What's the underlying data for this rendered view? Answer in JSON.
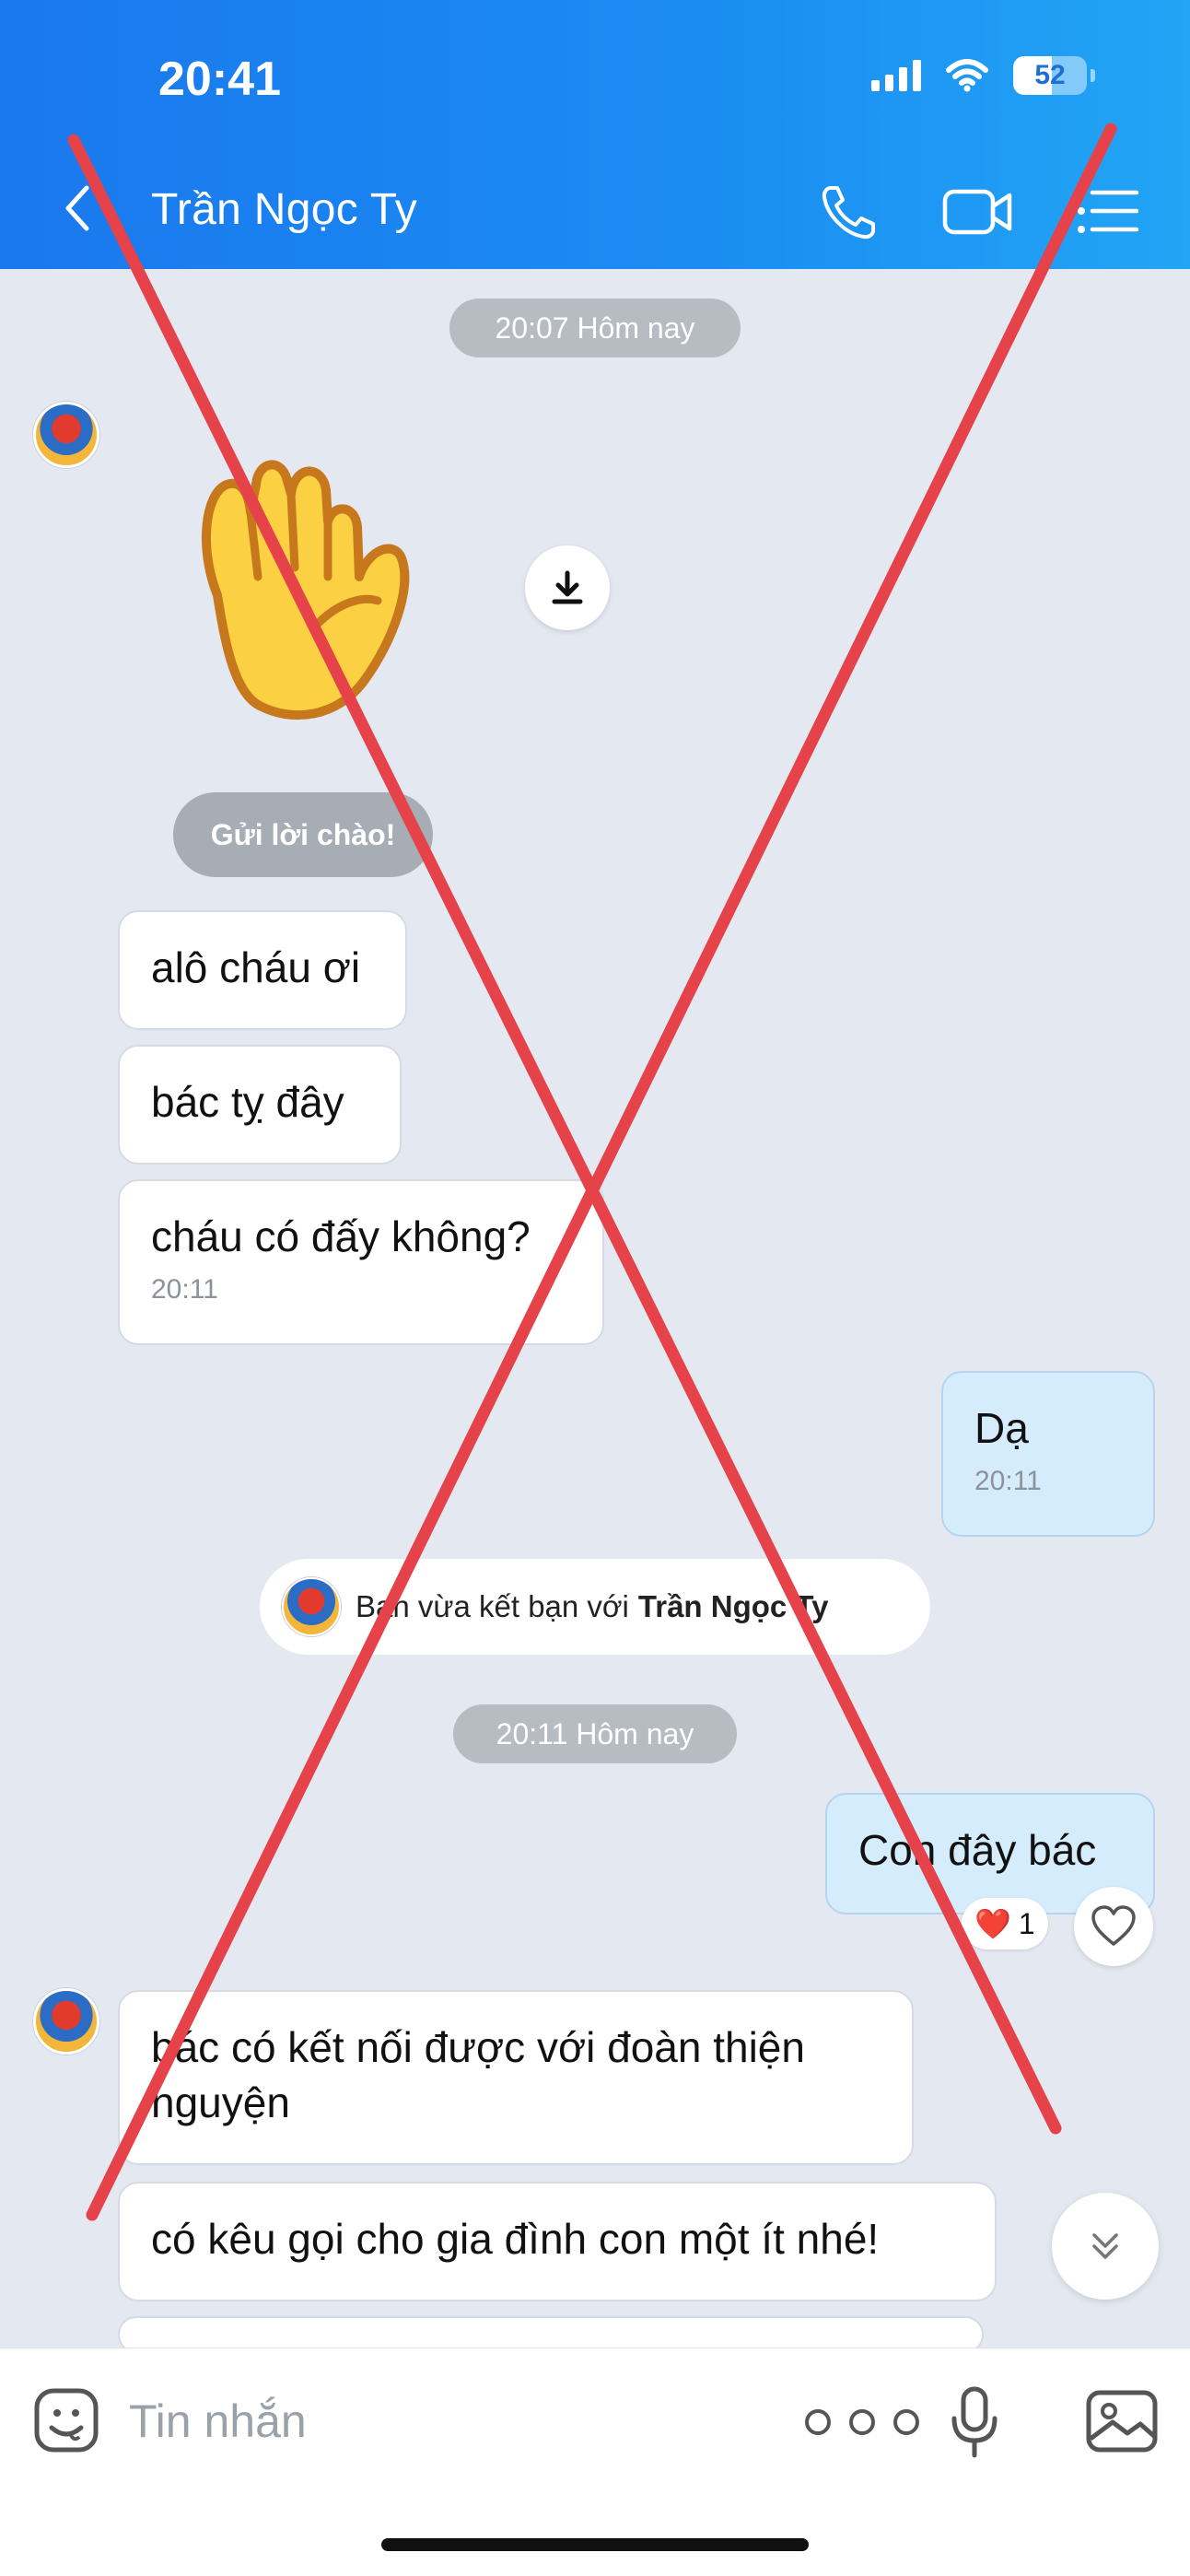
{
  "status_bar": {
    "time": "20:41",
    "battery": "52"
  },
  "header": {
    "contact_name": "Trần Ngọc Ty"
  },
  "timestamps": [
    "20:07 Hôm nay",
    "20:11 Hôm nay"
  ],
  "greeting_button": "Gửi lời chào!",
  "messages": [
    {
      "text": "alô cháu ơi"
    },
    {
      "text": "bác tỵ đây"
    },
    {
      "text": "cháu có đấy không?",
      "time": "20:11"
    },
    {
      "text": "Dạ",
      "time": "20:11",
      "sender": "me"
    },
    {
      "text": "Con đây bác",
      "sender": "me"
    },
    {
      "text": "bác có kết nối được với đoàn thiện nguyện"
    },
    {
      "text": "có kêu gọi cho gia đình con một ít nhé!"
    }
  ],
  "friend_notice": {
    "prefix": "Bạn vừa kết bạn với",
    "name": "Trần Ngọc Ty"
  },
  "reaction": {
    "emoji": "❤️",
    "count": "1"
  },
  "input": {
    "placeholder": "Tin nhắn"
  },
  "icons": [
    "back-icon",
    "phone-icon",
    "video-icon",
    "menu-icon",
    "download-icon",
    "heart-icon",
    "chevron-double-down-icon",
    "emoji-icon",
    "more-icon",
    "mic-icon",
    "image-icon"
  ],
  "colors": {
    "header": "#1b8df2",
    "bubble_me": "#d5ecfd",
    "background": "#e4e8f0",
    "cross": "#e5424a"
  }
}
